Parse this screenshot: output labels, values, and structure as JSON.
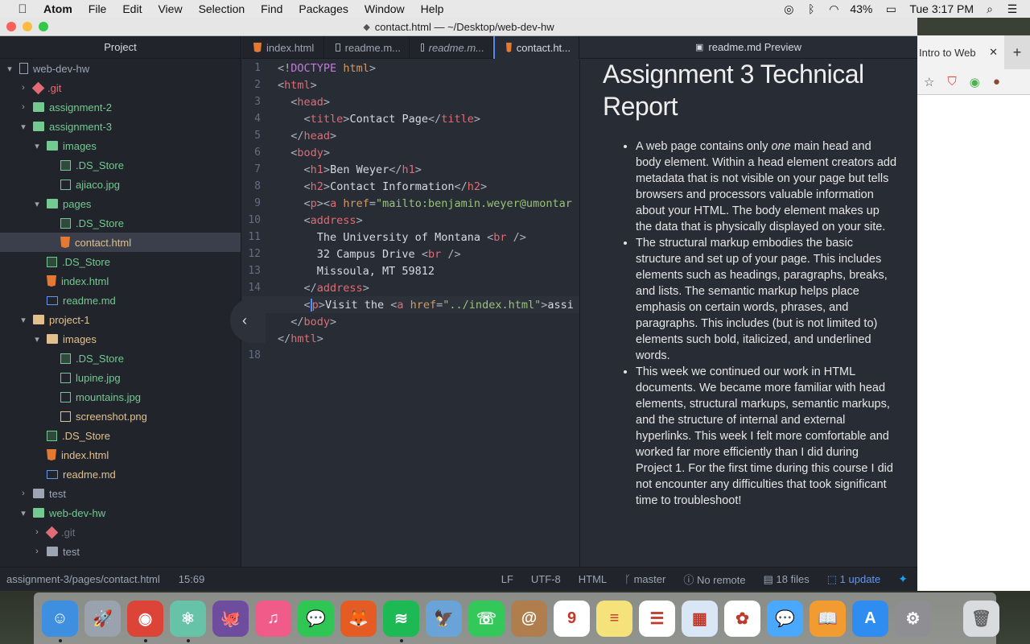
{
  "menubar": {
    "apple_icon": "apple-icon",
    "items": [
      "Atom",
      "File",
      "Edit",
      "View",
      "Selection",
      "Find",
      "Packages",
      "Window",
      "Help"
    ],
    "battery": "43%",
    "clock": "Tue 3:17 PM"
  },
  "window": {
    "title": "contact.html — ~/Desktop/web-dev-hw"
  },
  "tree": {
    "header": "Project",
    "rows": [
      {
        "label": "web-dev-hw",
        "depth": 0,
        "arrow": "▾",
        "icon": "repo-icon",
        "color": "gray"
      },
      {
        "label": ".git",
        "depth": 1,
        "arrow": "›",
        "icon": "git-icon",
        "color": "red"
      },
      {
        "label": "assignment-2",
        "depth": 1,
        "arrow": "›",
        "icon": "folder-icon",
        "color": "green"
      },
      {
        "label": "assignment-3",
        "depth": 1,
        "arrow": "▾",
        "icon": "folder-icon",
        "color": "green"
      },
      {
        "label": "images",
        "depth": 2,
        "arrow": "▾",
        "icon": "folder-icon",
        "color": "green"
      },
      {
        "label": ".DS_Store",
        "depth": 3,
        "arrow": "",
        "icon": "store-icon",
        "color": "green"
      },
      {
        "label": "ajiaco.jpg",
        "depth": 3,
        "arrow": "",
        "icon": "image-icon",
        "color": "green"
      },
      {
        "label": "pages",
        "depth": 2,
        "arrow": "▾",
        "icon": "folder-icon",
        "color": "green"
      },
      {
        "label": ".DS_Store",
        "depth": 3,
        "arrow": "",
        "icon": "store-icon",
        "color": "green"
      },
      {
        "label": "contact.html",
        "depth": 3,
        "arrow": "",
        "icon": "html-icon",
        "color": "orange",
        "selected": true
      },
      {
        "label": ".DS_Store",
        "depth": 2,
        "arrow": "",
        "icon": "store-icon",
        "color": "green"
      },
      {
        "label": "index.html",
        "depth": 2,
        "arrow": "",
        "icon": "html-icon",
        "color": "green"
      },
      {
        "label": "readme.md",
        "depth": 2,
        "arrow": "",
        "icon": "markdown-icon",
        "color": "green"
      },
      {
        "label": "project-1",
        "depth": 1,
        "arrow": "▾",
        "icon": "folder-icon",
        "color": "orange"
      },
      {
        "label": "images",
        "depth": 2,
        "arrow": "▾",
        "icon": "folder-icon",
        "color": "orange"
      },
      {
        "label": ".DS_Store",
        "depth": 3,
        "arrow": "",
        "icon": "store-icon",
        "color": "green"
      },
      {
        "label": "lupine.jpg",
        "depth": 3,
        "arrow": "",
        "icon": "image-icon",
        "color": "green"
      },
      {
        "label": "mountains.jpg",
        "depth": 3,
        "arrow": "",
        "icon": "image-icon",
        "color": "green"
      },
      {
        "label": "screenshot.png",
        "depth": 3,
        "arrow": "",
        "icon": "image-icon",
        "color": "orange"
      },
      {
        "label": ".DS_Store",
        "depth": 2,
        "arrow": "",
        "icon": "store-icon",
        "color": "orange"
      },
      {
        "label": "index.html",
        "depth": 2,
        "arrow": "",
        "icon": "html-icon",
        "color": "orange"
      },
      {
        "label": "readme.md",
        "depth": 2,
        "arrow": "",
        "icon": "markdown-icon",
        "color": "orange"
      },
      {
        "label": "test",
        "depth": 1,
        "arrow": "›",
        "icon": "folder-icon",
        "color": "gray"
      },
      {
        "label": "web-dev-hw",
        "depth": 1,
        "arrow": "▾",
        "icon": "folder-icon",
        "color": "green"
      },
      {
        "label": ".git",
        "depth": 2,
        "arrow": "›",
        "icon": "git-icon",
        "color": "muted"
      },
      {
        "label": "test",
        "depth": 2,
        "arrow": "›",
        "icon": "folder-icon",
        "color": "gray"
      }
    ]
  },
  "tabs": [
    {
      "label": "index.html",
      "icon": "html-icon",
      "italic": false,
      "active": false
    },
    {
      "label": "readme.m...",
      "icon": "markdown-icon",
      "italic": false,
      "active": false
    },
    {
      "label": "readme.m...",
      "icon": "markdown-icon",
      "italic": true,
      "active": false
    },
    {
      "label": "contact.ht...",
      "icon": "html-icon",
      "italic": false,
      "active": true
    }
  ],
  "preview_tab": {
    "label": "readme.md Preview",
    "icon": "markdown-icon"
  },
  "editor": {
    "current_line": 15,
    "lines": [
      [
        [
          "punc",
          "<!"
        ],
        [
          "kw",
          "DOCTYPE"
        ],
        [
          "text",
          " "
        ],
        [
          "attr",
          "html"
        ],
        [
          "punc",
          ">"
        ]
      ],
      [
        [
          "punc",
          "<"
        ],
        [
          "tag",
          "html"
        ],
        [
          "punc",
          ">"
        ]
      ],
      [
        [
          "text",
          "  "
        ],
        [
          "punc",
          "<"
        ],
        [
          "tag",
          "head"
        ],
        [
          "punc",
          ">"
        ]
      ],
      [
        [
          "text",
          "    "
        ],
        [
          "punc",
          "<"
        ],
        [
          "tag",
          "title"
        ],
        [
          "punc",
          ">"
        ],
        [
          "text",
          "Contact Page"
        ],
        [
          "punc",
          "</"
        ],
        [
          "tag",
          "title"
        ],
        [
          "punc",
          ">"
        ]
      ],
      [
        [
          "text",
          "  "
        ],
        [
          "punc",
          "</"
        ],
        [
          "tag",
          "head"
        ],
        [
          "punc",
          ">"
        ]
      ],
      [
        [
          "text",
          "  "
        ],
        [
          "punc",
          "<"
        ],
        [
          "tag",
          "body"
        ],
        [
          "punc",
          ">"
        ]
      ],
      [
        [
          "text",
          "    "
        ],
        [
          "punc",
          "<"
        ],
        [
          "tag",
          "h1"
        ],
        [
          "punc",
          ">"
        ],
        [
          "text",
          "Ben Weyer"
        ],
        [
          "punc",
          "</"
        ],
        [
          "tag",
          "h1"
        ],
        [
          "punc",
          ">"
        ]
      ],
      [
        [
          "text",
          "    "
        ],
        [
          "punc",
          "<"
        ],
        [
          "tag",
          "h2"
        ],
        [
          "punc",
          ">"
        ],
        [
          "text",
          "Contact Information"
        ],
        [
          "punc",
          "</"
        ],
        [
          "tag",
          "h2"
        ],
        [
          "punc",
          ">"
        ]
      ],
      [
        [
          "text",
          "    "
        ],
        [
          "punc",
          "<"
        ],
        [
          "tag",
          "p"
        ],
        [
          "punc",
          "><"
        ],
        [
          "tag",
          "a"
        ],
        [
          "text",
          " "
        ],
        [
          "attr",
          "href"
        ],
        [
          "punc",
          "="
        ],
        [
          "str",
          "\"mailto:benjamin.weyer@umontar"
        ]
      ],
      [
        [
          "text",
          "    "
        ],
        [
          "punc",
          "<"
        ],
        [
          "tag",
          "address"
        ],
        [
          "punc",
          ">"
        ]
      ],
      [
        [
          "text",
          "      The University of Montana "
        ],
        [
          "punc",
          "<"
        ],
        [
          "tag",
          "br"
        ],
        [
          "punc",
          " />"
        ]
      ],
      [
        [
          "text",
          "      32 Campus Drive "
        ],
        [
          "punc",
          "<"
        ],
        [
          "tag",
          "br"
        ],
        [
          "punc",
          " />"
        ]
      ],
      [
        [
          "text",
          "      Missoula, MT 59812"
        ]
      ],
      [
        [
          "text",
          "    "
        ],
        [
          "punc",
          "</"
        ],
        [
          "tag",
          "address"
        ],
        [
          "punc",
          ">"
        ]
      ],
      [
        [
          "text",
          "    "
        ],
        [
          "punc",
          "<"
        ],
        [
          "tag",
          "p"
        ],
        [
          "punc",
          ">"
        ],
        [
          "text",
          "Visit the "
        ],
        [
          "punc",
          "<"
        ],
        [
          "tag",
          "a"
        ],
        [
          "text",
          " "
        ],
        [
          "attr",
          "href"
        ],
        [
          "punc",
          "="
        ],
        [
          "str",
          "\"../index.html\""
        ],
        [
          "punc",
          ">"
        ],
        [
          "text",
          "assi"
        ]
      ],
      [
        [
          "text",
          "  "
        ],
        [
          "punc",
          "</"
        ],
        [
          "tag",
          "body"
        ],
        [
          "punc",
          ">"
        ]
      ],
      [
        [
          "punc",
          "</"
        ],
        [
          "tag",
          "hmtl"
        ],
        [
          "punc",
          ">"
        ]
      ],
      []
    ]
  },
  "preview": {
    "heading": "Assignment 3 Technical Report",
    "bullets": [
      [
        {
          "t": "A web page contains only "
        },
        {
          "t": "one",
          "em": true
        },
        {
          "t": " main head and body element. Within a head element creators add metadata that is not visible on your page but tells browsers and processors valuable information about your HTML. The body element makes up the data that is physically displayed on your site."
        }
      ],
      [
        {
          "t": "The structural markup embodies the basic structure and set up of your page. This includes elements such as headings, paragraphs, breaks, and lists. The semantic markup helps place emphasis on certain words, phrases, and paragraphs. This includes (but is not limited to) elements such bold, italicized, and underlined words."
        }
      ],
      [
        {
          "t": "This week we continued our work in HTML documents. We became more familiar with head elements, structural markups, semantic markups, and the structure of internal and external hyperlinks. This week I felt more comfortable and worked far more efficiently than I did during Project 1. For the first time during this course I did not encounter any difficulties that took significant time to troubleshoot!"
        }
      ]
    ]
  },
  "statusbar": {
    "path": "assignment-3/pages/contact.html",
    "cursor": "15:69",
    "line_ending": "LF",
    "encoding": "UTF-8",
    "grammar": "HTML",
    "branch": "master",
    "remote": "No remote",
    "files": "18 files",
    "updates": "1 update"
  },
  "chrome": {
    "tab_label": "Intro to Web"
  },
  "dock": {
    "apps": [
      {
        "name": "finder",
        "color": "#3f8fe0",
        "glyph": "☺",
        "running": true
      },
      {
        "name": "launchpad",
        "color": "#9aa3ad",
        "glyph": "🚀",
        "running": false
      },
      {
        "name": "chrome",
        "color": "#db4437",
        "glyph": "◉",
        "running": true
      },
      {
        "name": "atom",
        "color": "#66c3a8",
        "glyph": "⚛",
        "running": true
      },
      {
        "name": "github-desktop",
        "color": "#6e4c9e",
        "glyph": "🐙",
        "running": false
      },
      {
        "name": "itunes",
        "color": "#f05b8a",
        "glyph": "♫",
        "running": false
      },
      {
        "name": "messages-app",
        "color": "#2fc653",
        "glyph": "💬",
        "running": false
      },
      {
        "name": "firefox",
        "color": "#e55b24",
        "glyph": "🦊",
        "running": false
      },
      {
        "name": "spotify",
        "color": "#1db954",
        "glyph": "≋",
        "running": true
      },
      {
        "name": "preview",
        "color": "#6aa3d8",
        "glyph": "🦅",
        "running": false
      },
      {
        "name": "facetime",
        "color": "#34c759",
        "glyph": "☏",
        "running": false
      },
      {
        "name": "contacts",
        "color": "#b07e4c",
        "glyph": "@",
        "running": false
      },
      {
        "name": "calendar",
        "color": "#ffffff",
        "glyph": "9",
        "running": false
      },
      {
        "name": "notes",
        "color": "#f5e27a",
        "glyph": "≡",
        "running": false
      },
      {
        "name": "reminders",
        "color": "#ffffff",
        "glyph": "☰",
        "running": false
      },
      {
        "name": "calendar-widget",
        "color": "#d8e6f5",
        "glyph": "▦",
        "running": false
      },
      {
        "name": "photos",
        "color": "#ffffff",
        "glyph": "✿",
        "running": false
      },
      {
        "name": "messages",
        "color": "#4aa8ff",
        "glyph": "💬",
        "running": false
      },
      {
        "name": "ibooks",
        "color": "#f29b30",
        "glyph": "📖",
        "running": false
      },
      {
        "name": "app-store",
        "color": "#2f8cf0",
        "glyph": "A",
        "running": false
      },
      {
        "name": "system-preferences",
        "color": "#8e8e93",
        "glyph": "⚙",
        "running": false
      }
    ],
    "trash": {
      "name": "trash",
      "color": "#d9dcdf",
      "glyph": "🗑"
    }
  }
}
